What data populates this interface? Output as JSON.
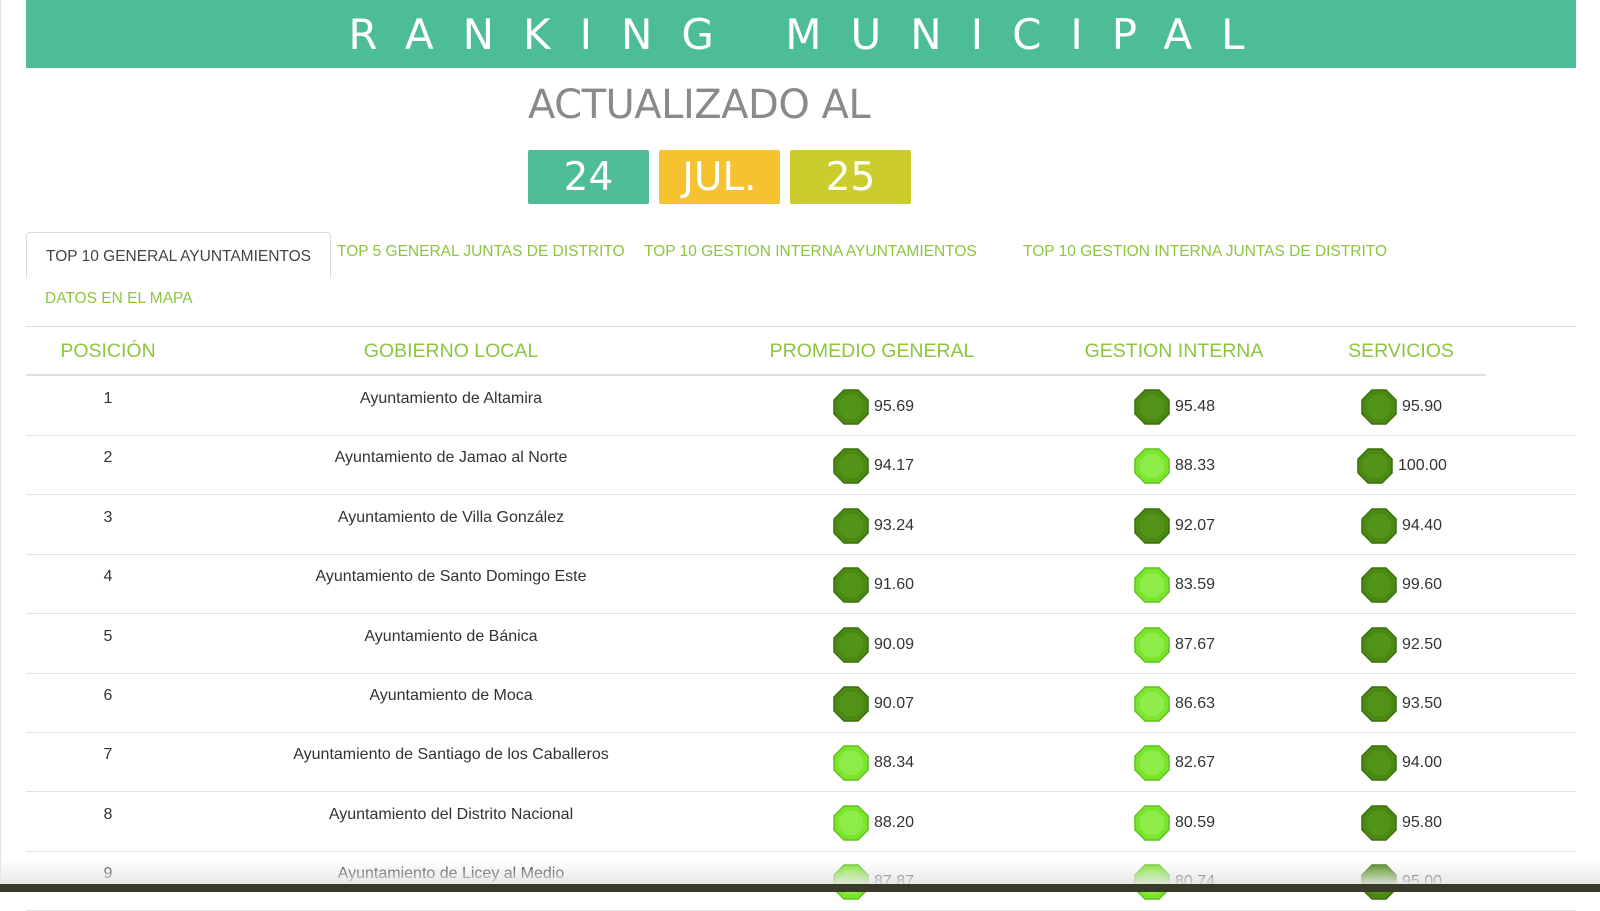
{
  "banner": {
    "title": "RANKING MUNICIPAL"
  },
  "updated": {
    "label": "ACTUALIZADO AL",
    "day": "24",
    "month": "JUL.",
    "year": "25"
  },
  "tabs": [
    {
      "label": "TOP 10 GENERAL AYUNTAMIENTOS",
      "active": true
    },
    {
      "label": "TOP 5 GENERAL JUNTAS DE DISTRITO",
      "active": false
    },
    {
      "label": "TOP 10 GESTION INTERNA AYUNTAMIENTOS",
      "active": false
    },
    {
      "label": "TOP 10 GESTION INTERNA JUNTAS DE DISTRITO",
      "active": false
    },
    {
      "label": "DATOS EN EL MAPA",
      "active": false
    }
  ],
  "table": {
    "headers": {
      "position": "POSICIÓN",
      "government": "GOBIERNO LOCAL",
      "general": "PROMEDIO GENERAL",
      "internal": "GESTION INTERNA",
      "services": "SERVICIOS"
    },
    "colors": {
      "dark_gem": "#4a8a12",
      "light_gem": "#7be52c",
      "accent": "#8cc63f"
    },
    "rows": [
      {
        "pos": "1",
        "name": "Ayuntamiento de Altamira",
        "general": "95.69",
        "general_level": "dark",
        "internal": "95.48",
        "internal_level": "dark",
        "services": "95.90",
        "services_level": "dark"
      },
      {
        "pos": "2",
        "name": "Ayuntamiento de Jamao al Norte",
        "general": "94.17",
        "general_level": "dark",
        "internal": "88.33",
        "internal_level": "light",
        "services": "100.00",
        "services_level": "dark"
      },
      {
        "pos": "3",
        "name": "Ayuntamiento de Villa González",
        "general": "93.24",
        "general_level": "dark",
        "internal": "92.07",
        "internal_level": "dark",
        "services": "94.40",
        "services_level": "dark"
      },
      {
        "pos": "4",
        "name": "Ayuntamiento de Santo Domingo Este",
        "general": "91.60",
        "general_level": "dark",
        "internal": "83.59",
        "internal_level": "light",
        "services": "99.60",
        "services_level": "dark"
      },
      {
        "pos": "5",
        "name": "Ayuntamiento de Bánica",
        "general": "90.09",
        "general_level": "dark",
        "internal": "87.67",
        "internal_level": "light",
        "services": "92.50",
        "services_level": "dark"
      },
      {
        "pos": "6",
        "name": "Ayuntamiento de Moca",
        "general": "90.07",
        "general_level": "dark",
        "internal": "86.63",
        "internal_level": "light",
        "services": "93.50",
        "services_level": "dark"
      },
      {
        "pos": "7",
        "name": "Ayuntamiento de Santiago de los Caballeros",
        "general": "88.34",
        "general_level": "light",
        "internal": "82.67",
        "internal_level": "light",
        "services": "94.00",
        "services_level": "dark"
      },
      {
        "pos": "8",
        "name": "Ayuntamiento del Distrito Nacional",
        "general": "88.20",
        "general_level": "light",
        "internal": "80.59",
        "internal_level": "light",
        "services": "95.80",
        "services_level": "dark"
      },
      {
        "pos": "9",
        "name": "Ayuntamiento de Licey al Medio",
        "general": "87.87",
        "general_level": "light",
        "internal": "80.74",
        "internal_level": "light",
        "services": "95.00",
        "services_level": "dark"
      }
    ]
  }
}
